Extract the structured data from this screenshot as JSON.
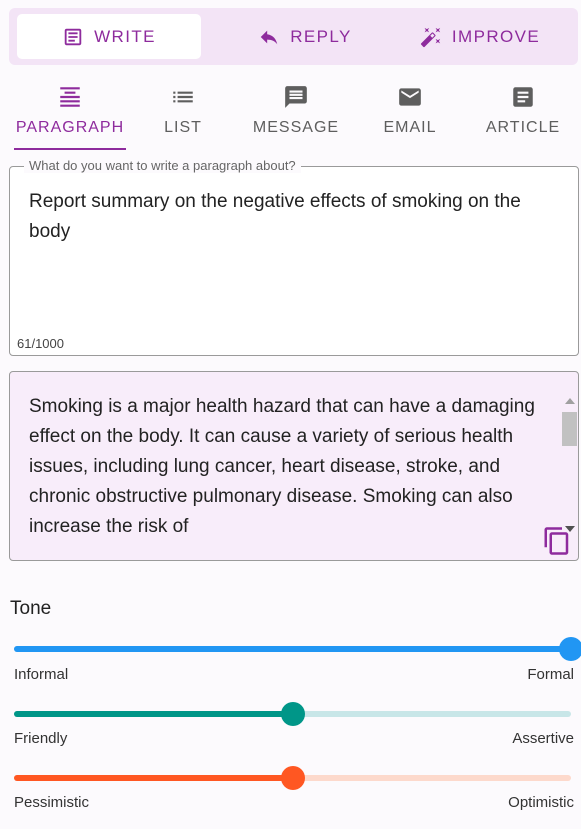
{
  "top_tabs": [
    {
      "label": "WRITE",
      "icon": "note-icon",
      "active": true
    },
    {
      "label": "REPLY",
      "icon": "reply-icon",
      "active": false
    },
    {
      "label": "IMPROVE",
      "icon": "magic-wand-icon",
      "active": false
    }
  ],
  "mode_tabs": [
    {
      "label": "PARAGRAPH",
      "icon": "paragraph-icon",
      "active": true
    },
    {
      "label": "LIST",
      "icon": "list-icon",
      "active": false
    },
    {
      "label": "MESSAGE",
      "icon": "message-icon",
      "active": false
    },
    {
      "label": "EMAIL",
      "icon": "email-icon",
      "active": false
    },
    {
      "label": "ARTICLE",
      "icon": "article-icon",
      "active": false
    }
  ],
  "prompt": {
    "legend": "What do you want to write a paragraph about?",
    "value": "Report summary on the negative effects of smoking on the body",
    "counter": "61/1000"
  },
  "output": {
    "text": "Smoking is a major health hazard that can have a damaging effect on the body. It can cause a variety of serious health issues, including lung cancer, heart disease, stroke, and chronic obstructive pulmonary disease. Smoking can also increase the risk of",
    "copy_icon": "copy-icon"
  },
  "tone": {
    "title": "Tone",
    "sliders": [
      {
        "min_label": "Informal",
        "max_label": "Formal",
        "value": 1.0,
        "color": "#2196f3",
        "rail_color": "#bbdefb"
      },
      {
        "min_label": "Friendly",
        "max_label": "Assertive",
        "value": 0.5,
        "color": "#009688",
        "rail_color": "#c8e6e8"
      },
      {
        "min_label": "Pessimistic",
        "max_label": "Optimistic",
        "value": 0.5,
        "color": "#ff5722",
        "rail_color": "#fdd9cc"
      }
    ]
  },
  "colors": {
    "accent": "#8e2b9d",
    "top_bar_bg": "#f3e4f6",
    "output_bg": "#f8edfa"
  }
}
